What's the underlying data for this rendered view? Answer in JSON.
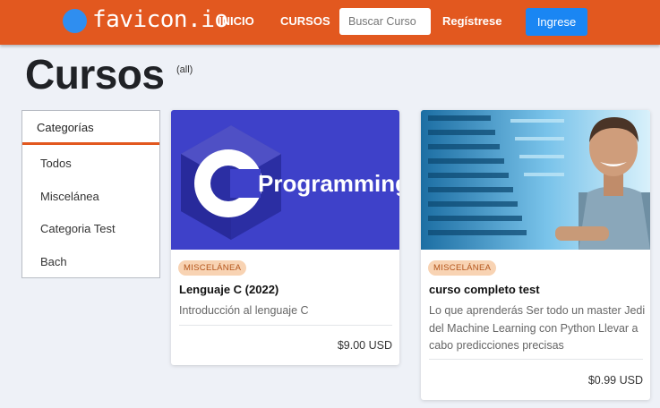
{
  "navbar": {
    "brand": "favicon.io",
    "links": [
      "INICIO",
      "CURSOS"
    ],
    "search_placeholder": "Buscar Curso",
    "register_label": "Regístrese",
    "login_label": "Ingrese"
  },
  "page": {
    "title": "Cursos",
    "subtitle": "(all)"
  },
  "sidebar": {
    "heading": "Categorías",
    "items": [
      {
        "label": "Todos"
      },
      {
        "label": "Miscelánea"
      },
      {
        "label": "Categoria Test"
      },
      {
        "label": "Bach"
      }
    ]
  },
  "courses": [
    {
      "image_text": "Programming",
      "image_letter": "C",
      "category": "MISCELÁNEA",
      "title": "Lenguaje C (2022)",
      "description_lines": [
        "Introducción al lenguaje C"
      ],
      "price": "$9.00 USD"
    },
    {
      "category": "MISCELÁNEA",
      "title": "curso completo test",
      "description_lines": [
        "Lo que aprenderás Ser todo un master Jedi",
        "del Machine Learning con Python Llevar a",
        "cabo predicciones precisas"
      ],
      "price": "$0.99 USD"
    }
  ],
  "colors": {
    "navbar": "#e2581f",
    "accent_blue": "#1a86f3",
    "badge_bg": "#f8d3b3",
    "c_card_bg": "#3e41c9"
  }
}
